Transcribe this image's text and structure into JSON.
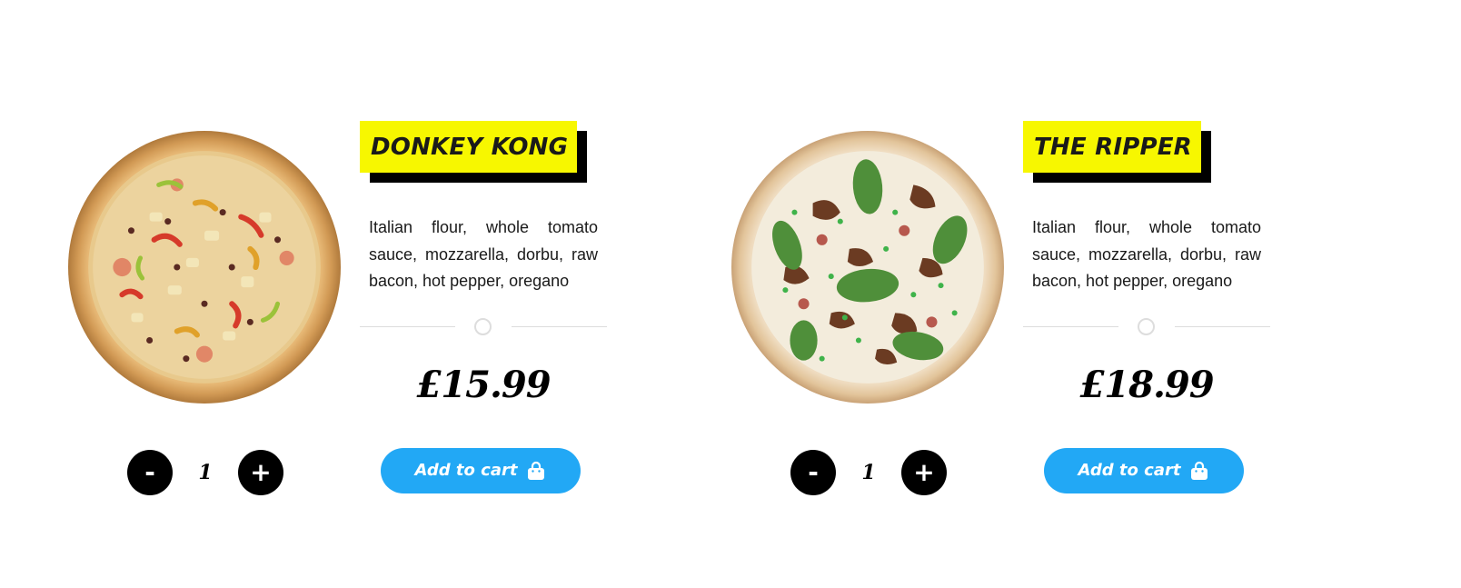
{
  "products": [
    {
      "name": "DONKEY KONG",
      "description": "Italian flour, whole tomato sauce, mozzarella, dorbu, raw bacon, hot pepper, oregano",
      "price": "£15.99",
      "quantity": "1",
      "minus_label": "-",
      "plus_label": "+",
      "cart_label": "Add to cart",
      "image_icon": "pizza-image-cheese-peppers"
    },
    {
      "name": "THE RIPPER",
      "description": "Italian flour, whole tomato sauce, mozzarella, dorbu, raw bacon, hot pepper, oregano",
      "price": "£18.99",
      "quantity": "1",
      "minus_label": "-",
      "plus_label": "+",
      "cart_label": "Add to cart",
      "image_icon": "pizza-image-mushroom-spinach"
    }
  ],
  "colors": {
    "title_highlight": "#f7f700",
    "cart_button": "#22a8f5",
    "qty_button": "#000000",
    "divider": "#dddddd"
  }
}
